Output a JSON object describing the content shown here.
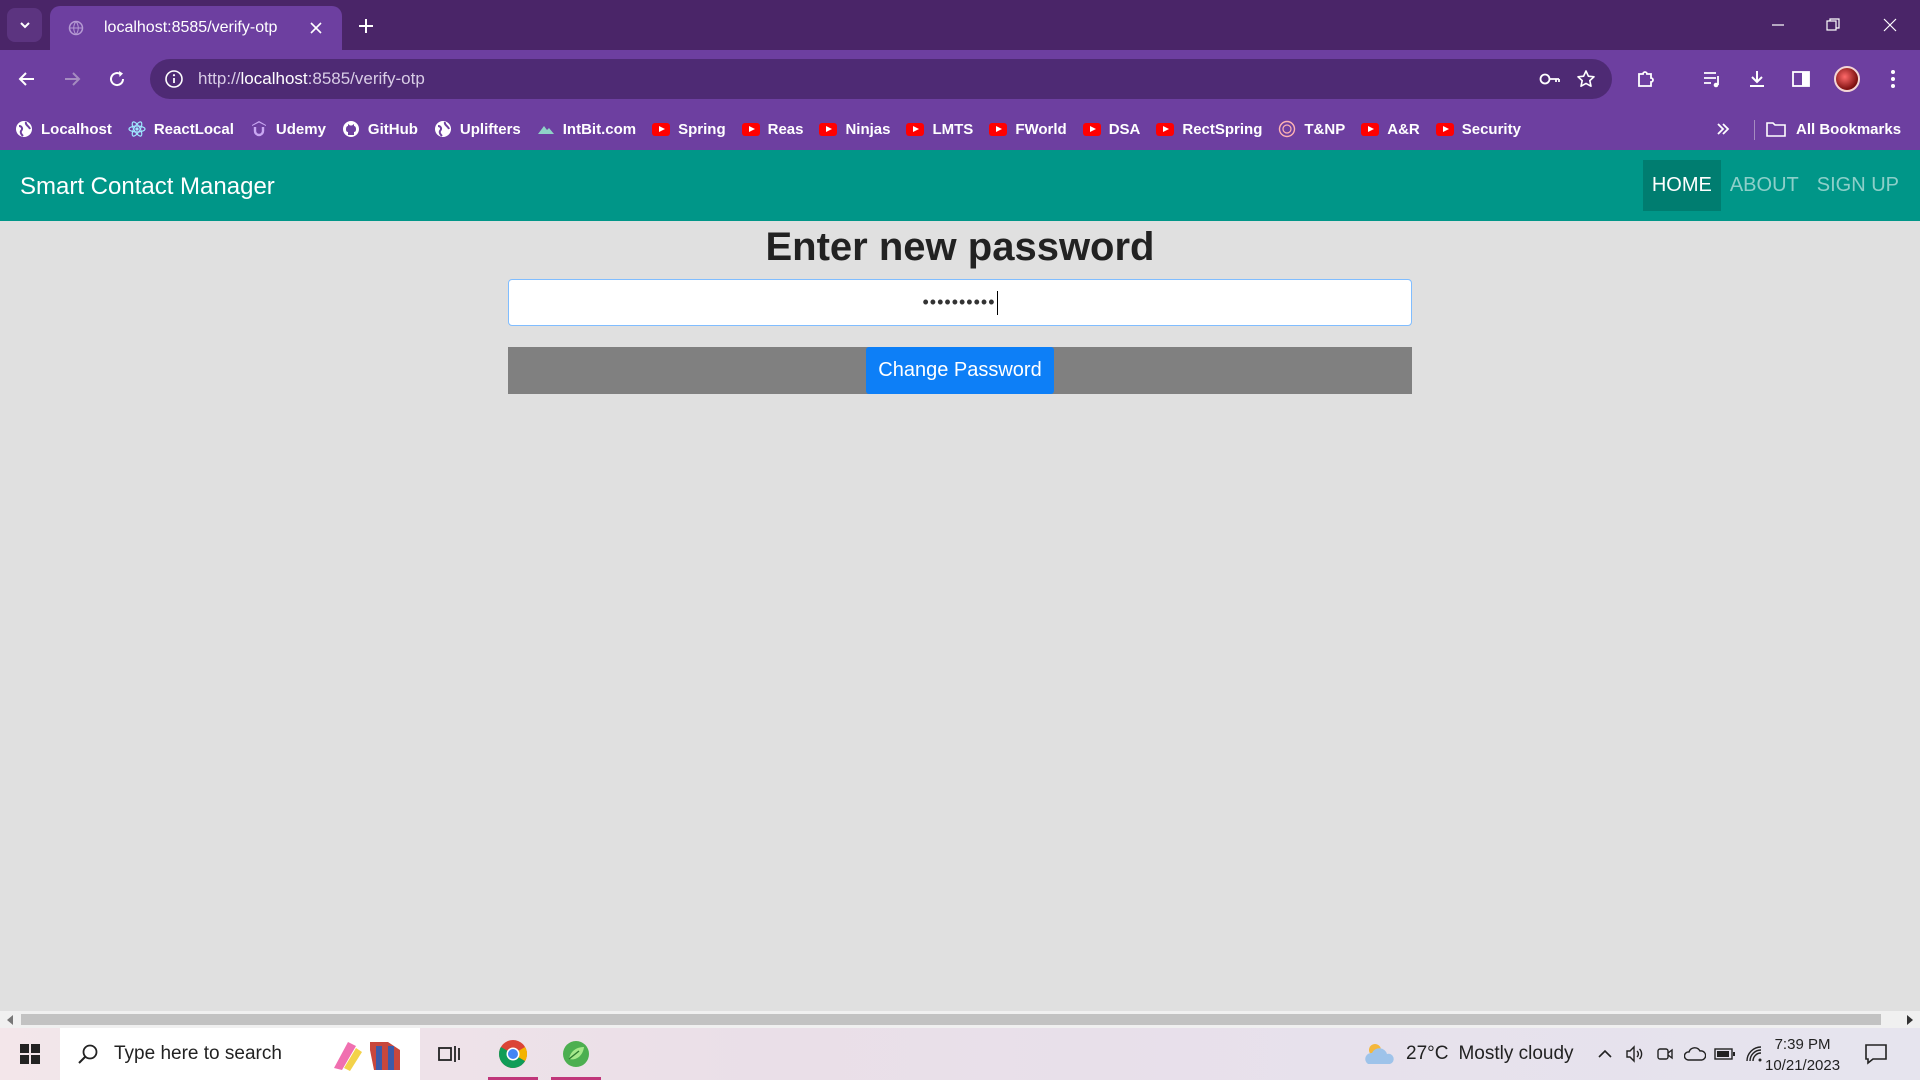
{
  "browser": {
    "tab_title": "localhost:8585/verify-otp",
    "url_scheme_prefix": "http://",
    "url_host": "localhost",
    "url_rest": ":8585/verify-otp",
    "bookmarks": [
      {
        "label": "Localhost",
        "icon": "globe-icon"
      },
      {
        "label": "ReactLocal",
        "icon": "react-icon"
      },
      {
        "label": "Udemy",
        "icon": "udemy-icon"
      },
      {
        "label": "GitHub",
        "icon": "github-icon"
      },
      {
        "label": "Uplifters",
        "icon": "globe-icon"
      },
      {
        "label": "IntBit.com",
        "icon": "mountain-icon"
      },
      {
        "label": "Spring",
        "icon": "youtube-icon"
      },
      {
        "label": "Reas",
        "icon": "youtube-icon"
      },
      {
        "label": "Ninjas",
        "icon": "youtube-icon"
      },
      {
        "label": "LMTS",
        "icon": "youtube-icon"
      },
      {
        "label": "FWorld",
        "icon": "youtube-icon"
      },
      {
        "label": "DSA",
        "icon": "youtube-icon"
      },
      {
        "label": "RectSpring",
        "icon": "youtube-icon"
      },
      {
        "label": "T&NP",
        "icon": "seal-icon"
      },
      {
        "label": "A&R",
        "icon": "youtube-icon"
      },
      {
        "label": "Security",
        "icon": "youtube-icon"
      }
    ],
    "all_bookmarks_label": "All Bookmarks",
    "theme_color": "#6d3fa0"
  },
  "app": {
    "brand": "Smart Contact Manager",
    "nav": {
      "home": "HOME",
      "about": "ABOUT",
      "signup": "SIGN UP"
    },
    "navbar_color": "#009688"
  },
  "form": {
    "heading": "Enter new password",
    "password_masked": "••••••••••",
    "submit_label": "Change Password",
    "button_color": "#0d7ff7"
  },
  "taskbar": {
    "search_placeholder": "Type here to search",
    "weather_temp": "27°C",
    "weather_text": "Mostly cloudy",
    "time": "7:39 PM",
    "date": "10/21/2023"
  }
}
